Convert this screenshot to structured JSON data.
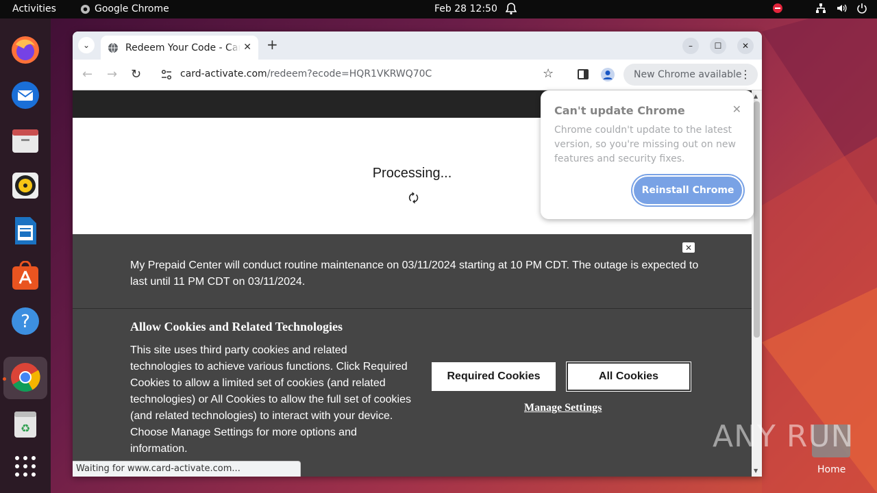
{
  "topbar": {
    "activities": "Activities",
    "app_name": "Google Chrome",
    "clock": "Feb 28  12:50"
  },
  "dock": {
    "items": [
      "Firefox",
      "Thunderbird",
      "Files",
      "Rhythmbox",
      "LibreOffice Writer",
      "Ubuntu Software",
      "Help",
      "Google Chrome",
      "Trash",
      "Show Applications"
    ]
  },
  "browser": {
    "tab_title": "Redeem Your Code - Card Activate",
    "url_host": "card-activate.com",
    "url_path": "/redeem?ecode=HQR1VKRWQ70C",
    "update_pill": "New Chrome available",
    "status_text": "Waiting for www.card-activate.com..."
  },
  "update_bubble": {
    "title": "Can't update Chrome",
    "text": "Chrome couldn't update to the latest version, so you're missing out on new features and security fixes.",
    "button": "Reinstall Chrome"
  },
  "page": {
    "processing": "Processing...",
    "maintenance": "My Prepaid Center will conduct routine maintenance on 03/11/2024 starting at 10 PM CDT. The outage is expected to last until 11 PM CDT on 03/11/2024.",
    "cookie_title": "Allow Cookies and Related Technologies",
    "cookie_body": "This site uses third party cookies and related technologies to achieve various functions. Click Required Cookies to allow a limited set of cookies (and related technologies) or All Cookies to allow the full set of cookies (and related technologies) to interact with your device. Choose Manage Settings for more options and information.",
    "required_btn": "Required Cookies",
    "all_btn": "All Cookies",
    "manage_link": "Manage Settings"
  },
  "desktop": {
    "home_label": "Home",
    "watermark": "ANY RUN"
  }
}
